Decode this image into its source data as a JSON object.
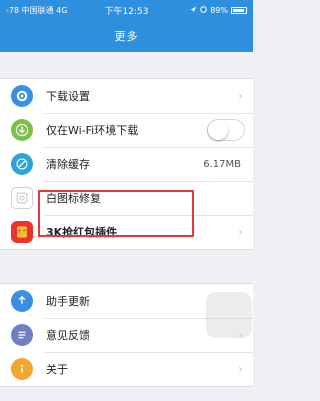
{
  "status_bar": {
    "left": "-78 中国联通 4G",
    "time": "下午12:53",
    "battery": "89%",
    "battery_level": 0.89
  },
  "nav": {
    "title": "更多"
  },
  "groups": [
    {
      "items": [
        {
          "label": "下载设置",
          "icon": "gear-icon",
          "accessory": "chevron"
        },
        {
          "label": "仅在Wi-Fi环境下载",
          "icon": "download-icon",
          "accessory": "toggle",
          "toggle_on": false
        },
        {
          "label": "清除缓存",
          "icon": "clear-cache-icon",
          "accessory": "value",
          "value": "6.17MB"
        },
        {
          "label": "白图标修复",
          "icon": "icon-repair-icon",
          "accessory": "none"
        },
        {
          "label": "3K抢红包插件",
          "icon": "red-envelope-icon",
          "accessory": "chevron"
        }
      ]
    },
    {
      "items": [
        {
          "label": "助手更新",
          "icon": "update-icon",
          "accessory": "none"
        },
        {
          "label": "意见反馈",
          "icon": "feedback-icon",
          "accessory": "chevron"
        },
        {
          "label": "关于",
          "icon": "about-icon",
          "accessory": "chevron"
        }
      ]
    }
  ],
  "colors": {
    "nav_blue": "#2f8fdf",
    "highlight_red": "#e53935"
  }
}
